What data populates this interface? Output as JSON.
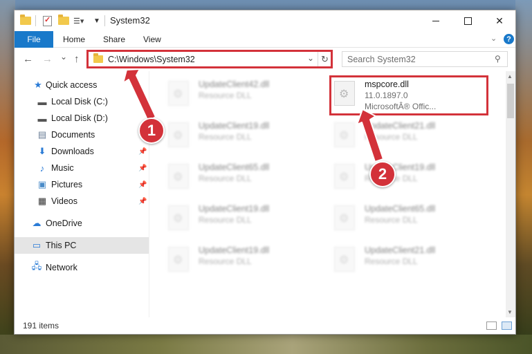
{
  "window": {
    "title": "System32",
    "controls": {
      "minimize": "",
      "maximize": "",
      "close": "✕"
    }
  },
  "ribbon": {
    "tabs": [
      "File",
      "Home",
      "Share",
      "View"
    ]
  },
  "navigation": {
    "back_icon": "←",
    "forward_icon": "→",
    "recent_icon": "⌄",
    "up_icon": "↑",
    "address": "C:\\Windows\\System32",
    "search_placeholder": "Search System32"
  },
  "nav_pane": {
    "items": [
      {
        "label": "Quick access",
        "icon": "star-icon"
      },
      {
        "label": "Local Disk (C:)",
        "icon": "drive-icon"
      },
      {
        "label": "Local Disk (D:)",
        "icon": "drive-icon"
      },
      {
        "label": "Documents",
        "icon": "documents-icon"
      },
      {
        "label": "Downloads",
        "icon": "downloads-icon"
      },
      {
        "label": "Music",
        "icon": "music-icon"
      },
      {
        "label": "Pictures",
        "icon": "pictures-icon"
      },
      {
        "label": "Videos",
        "icon": "videos-icon"
      },
      {
        "label": "OneDrive",
        "icon": "onedrive-icon"
      },
      {
        "label": "This PC",
        "icon": "pc-icon"
      },
      {
        "label": "Network",
        "icon": "network-icon"
      }
    ],
    "selected": "This PC"
  },
  "files": [
    {
      "name": "UpdateClient42.dll",
      "type": "Resource DLL"
    },
    {
      "name": "mspcore.dll",
      "version": "11.0.1897.0",
      "company": "MicrosoftÂ® Offic..."
    },
    {
      "name": "UpdateClient19.dll",
      "type": "Resource DLL"
    },
    {
      "name": "UpdateClient21.dll",
      "type": "Resource DLL"
    },
    {
      "name": "UpdateClient65.dll",
      "type": "Resource DLL"
    },
    {
      "name": "UpdateClient19.dll",
      "type": "Resource DLL"
    },
    {
      "name": "UpdateClient19.dll",
      "type": "Resource DLL"
    },
    {
      "name": "UpdateClient65.dll",
      "type": "Resource DLL"
    },
    {
      "name": "UpdateClient19.dll",
      "type": "Resource DLL"
    },
    {
      "name": "UpdateClient21.dll",
      "type": "Resource DLL"
    }
  ],
  "status": {
    "item_count": "191 items"
  },
  "annotations": {
    "step1": "1",
    "step2": "2",
    "color": "#d3323a"
  },
  "colors": {
    "accent": "#1979ca",
    "highlight": "#d3323a",
    "selection": "#e5e5e5"
  }
}
